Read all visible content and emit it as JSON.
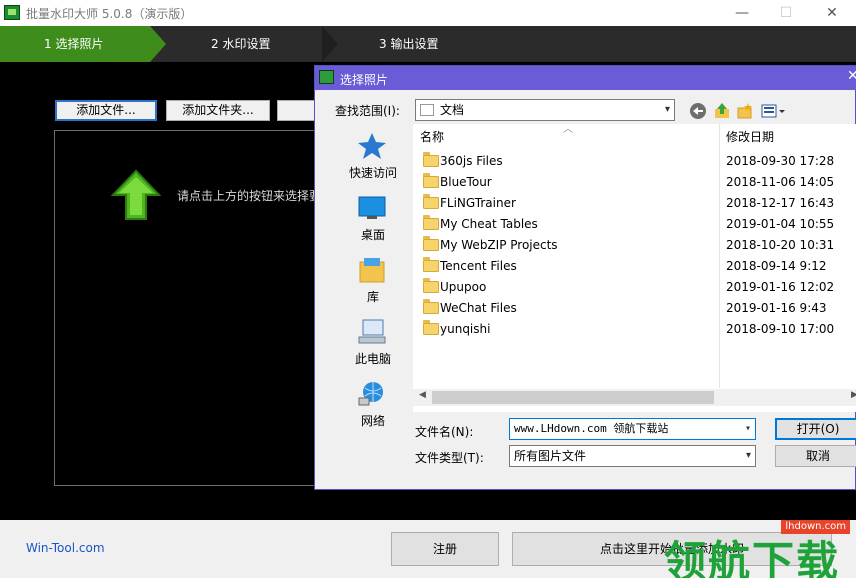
{
  "app": {
    "title": "批量水印大师 5.0.8（演示版）",
    "controls": {
      "minimize": "—",
      "maximize": "☐",
      "close": "✕"
    }
  },
  "steps": [
    {
      "label": "1 选择照片",
      "active": true
    },
    {
      "label": "2 水印设置",
      "active": false
    },
    {
      "label": "3 输出设置",
      "active": false
    }
  ],
  "toolbar": {
    "add_file": "添加文件...",
    "add_folder": "添加文件夹..."
  },
  "dropzone": {
    "hint": "请点击上方的按钮来选择要"
  },
  "bottom": {
    "link": "Win-Tool.com",
    "register": "注册",
    "start": "点击这里开始批量添加水印"
  },
  "dialog": {
    "title": "选择照片",
    "look_in_label": "查找范围(I):",
    "look_in_value": "文档",
    "places": [
      {
        "label": "快速访问",
        "icon": "star-icon"
      },
      {
        "label": "桌面",
        "icon": "desktop-icon"
      },
      {
        "label": "库",
        "icon": "library-icon"
      },
      {
        "label": "此电脑",
        "icon": "computer-icon"
      },
      {
        "label": "网络",
        "icon": "network-icon"
      }
    ],
    "columns": {
      "name": "名称",
      "date": "修改日期"
    },
    "files": [
      {
        "name": "360js Files",
        "date": "2018-09-30 17:28"
      },
      {
        "name": "BlueTour",
        "date": "2018-11-06 14:05"
      },
      {
        "name": "FLiNGTrainer",
        "date": "2018-12-17 16:43"
      },
      {
        "name": "My Cheat Tables",
        "date": "2019-01-04 10:55"
      },
      {
        "name": "My WebZIP Projects",
        "date": "2018-10-20 10:31"
      },
      {
        "name": "Tencent Files",
        "date": "2018-09-14 9:12"
      },
      {
        "name": "Upupoo",
        "date": "2019-01-16 12:02"
      },
      {
        "name": "WeChat Files",
        "date": "2019-01-16 9:43"
      },
      {
        "name": "yunqishi",
        "date": "2018-09-10 17:00"
      }
    ],
    "filename_label": "文件名(N):",
    "filename_value": "www.LHdown.com 领航下载站",
    "filetype_label": "文件类型(T):",
    "filetype_value": "所有图片文件",
    "open_button": "打开(O)",
    "cancel_button": "取消"
  },
  "watermark": {
    "text": "领航下载",
    "tag": "lhdown.com"
  },
  "colors": {
    "step_active": "#3e8d1c",
    "dialog_title": "#6a5bd6",
    "link": "#1a56c4"
  }
}
